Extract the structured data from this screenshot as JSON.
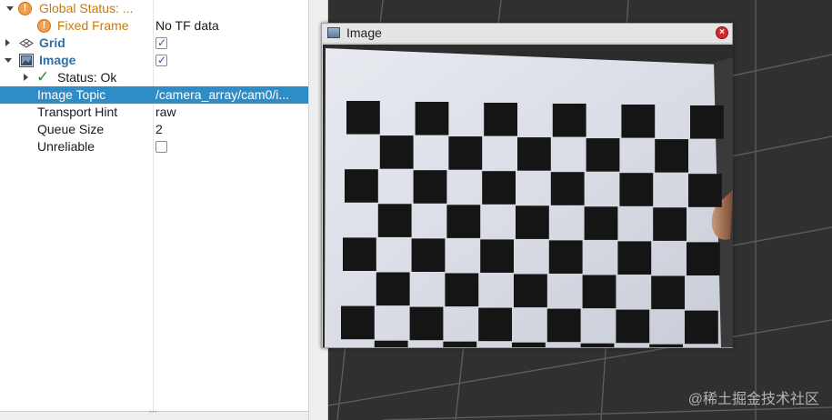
{
  "properties_panel": {
    "rows": [
      {
        "name": "Global Status: ...",
        "value": ""
      },
      {
        "name": "Fixed Frame",
        "value": "No TF data"
      },
      {
        "name": "Grid",
        "value": ""
      },
      {
        "name": "Image",
        "value": ""
      },
      {
        "name": "Status: Ok",
        "value": ""
      },
      {
        "name": "Image Topic",
        "value": "/camera_array/cam0/i..."
      },
      {
        "name": "Transport Hint",
        "value": "raw"
      },
      {
        "name": "Queue Size",
        "value": "2"
      },
      {
        "name": "Unreliable",
        "value": ""
      }
    ],
    "grid_enabled": true,
    "image_enabled": true,
    "unreliable_checked": false,
    "selected_row": "Image Topic"
  },
  "image_window": {
    "title": "Image"
  },
  "watermark": "@稀土掘金技术社区",
  "colors": {
    "selection": "#308cc6",
    "warning": "#c77a0a",
    "display_name": "#2f6fa8",
    "viewport_bg": "#303030"
  }
}
